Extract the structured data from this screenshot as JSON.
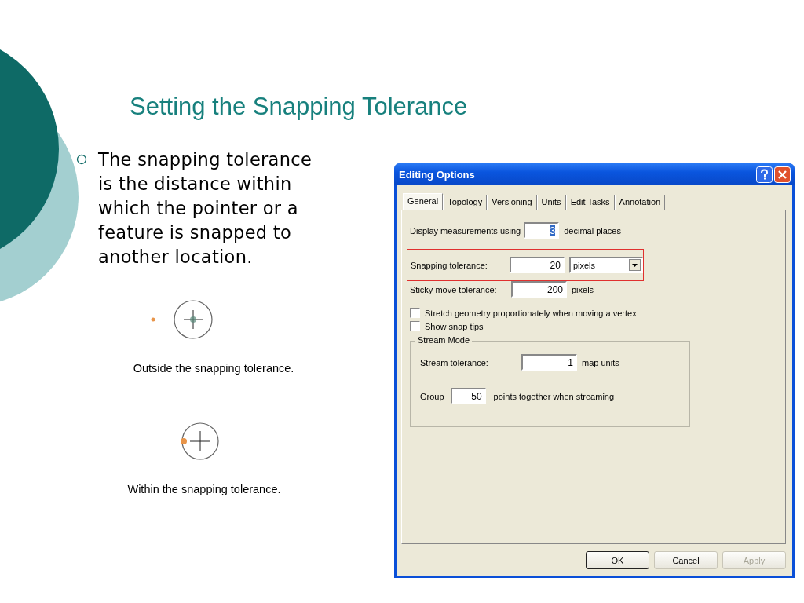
{
  "slide": {
    "title": "Setting the Snapping Tolerance",
    "bullet": "The snapping tolerance is the distance within which the pointer or a feature is snapped to another location.",
    "figures": [
      {
        "kind": "outside",
        "caption": "Outside the snapping tolerance."
      },
      {
        "kind": "within",
        "caption": "Within the snapping tolerance."
      }
    ]
  },
  "dialog": {
    "title": "Editing Options",
    "tabs": [
      {
        "label": "General",
        "selected": true
      },
      {
        "label": "Topology",
        "selected": false
      },
      {
        "label": "Versioning",
        "selected": false
      },
      {
        "label": "Units",
        "selected": false
      },
      {
        "label": "Edit Tasks",
        "selected": false
      },
      {
        "label": "Annotation",
        "selected": false
      }
    ],
    "display_measurements": {
      "label": "Display measurements using",
      "value": "3",
      "value_selected": true,
      "suffix": "decimal places"
    },
    "snapping_tolerance": {
      "label": "Snapping tolerance:",
      "value": "20",
      "units": "pixels",
      "highlighted": true
    },
    "sticky_move": {
      "label": "Sticky move tolerance:",
      "value": "200",
      "suffix": "pixels"
    },
    "checkboxes": [
      {
        "label": "Stretch geometry proportionately when moving a vertex",
        "checked": false
      },
      {
        "label": "Show snap tips",
        "checked": false
      }
    ],
    "stream_mode": {
      "title": "Stream Mode",
      "stream_tolerance": {
        "label": "Stream tolerance:",
        "value": "1",
        "suffix": "map units"
      },
      "group": {
        "label": "Group",
        "value": "50",
        "suffix": "points together when streaming"
      }
    },
    "buttons": [
      {
        "label": "OK",
        "default": true,
        "disabled": false
      },
      {
        "label": "Cancel",
        "default": false,
        "disabled": false
      },
      {
        "label": "Apply",
        "default": false,
        "disabled": true
      }
    ]
  }
}
